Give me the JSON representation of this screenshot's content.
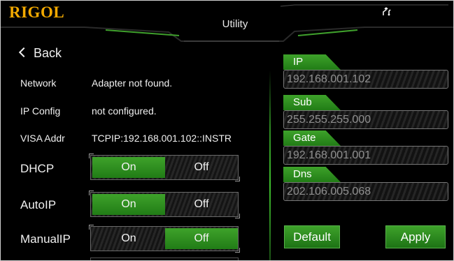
{
  "header": {
    "logo": "RIGOL",
    "title": "Utility"
  },
  "nav": {
    "back_label": "Back"
  },
  "info": {
    "network_label": "Network",
    "network_value": "Adapter not found.",
    "ipconfig_label": "IP Config",
    "ipconfig_value": "not configured.",
    "visa_label": "VISA Addr",
    "visa_value": "TCPIP:192.168.001.102::INSTR"
  },
  "toggles": {
    "dhcp": {
      "label": "DHCP",
      "on": "On",
      "off": "Off",
      "selected": "On"
    },
    "autoip": {
      "label": "AutoIP",
      "on": "On",
      "off": "Off",
      "selected": "On"
    },
    "manualip": {
      "label": "ManualIP",
      "on": "On",
      "off": "Off",
      "selected": "Off"
    }
  },
  "fields": {
    "ip": {
      "label": "IP",
      "value": "192.168.001.102"
    },
    "sub": {
      "label": "Sub",
      "value": "255.255.255.000"
    },
    "gate": {
      "label": "Gate",
      "value": "192.168.001.001"
    },
    "dns": {
      "label": "Dns",
      "value": "202.106.005.068"
    }
  },
  "buttons": {
    "default_label": "Default",
    "apply_label": "Apply"
  },
  "colors": {
    "accent_green": "#3ea22a",
    "logo": "#f2a900",
    "background": "#000000"
  }
}
